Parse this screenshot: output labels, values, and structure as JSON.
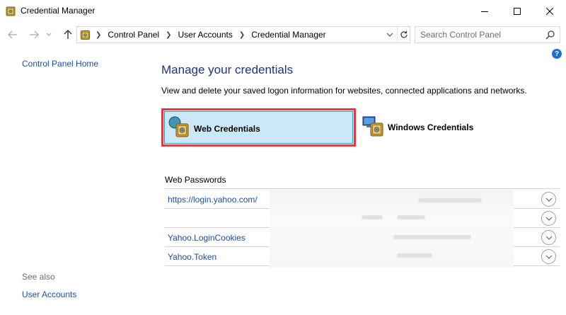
{
  "window": {
    "title": "Credential Manager"
  },
  "address": {
    "crumbs": [
      "Control Panel",
      "User Accounts",
      "Credential Manager"
    ],
    "search_placeholder": "Search Control Panel"
  },
  "help": {
    "label": "?"
  },
  "left_pane": {
    "home_link": "Control Panel Home",
    "see_also_label": "See also",
    "see_also_links": [
      "User Accounts"
    ]
  },
  "main": {
    "title": "Manage your credentials",
    "description": "View and delete your saved logon information for websites, connected applications and networks.",
    "tabs": [
      {
        "label": "Web Credentials",
        "selected": true,
        "icon": "globe-vault-icon"
      },
      {
        "label": "Windows Credentials",
        "selected": false,
        "icon": "computer-vault-icon"
      }
    ],
    "section_title": "Web Passwords",
    "rows": [
      {
        "name": "https://login.yahoo.com/"
      },
      {
        "name": ""
      },
      {
        "name": "Yahoo.LoginCookies"
      },
      {
        "name": "Yahoo.Token"
      }
    ]
  },
  "colors": {
    "link": "#1e4e9a",
    "title": "#1e3287",
    "selected_tab_bg": "#cbe8f6",
    "highlight_border": "#e23b3b"
  }
}
